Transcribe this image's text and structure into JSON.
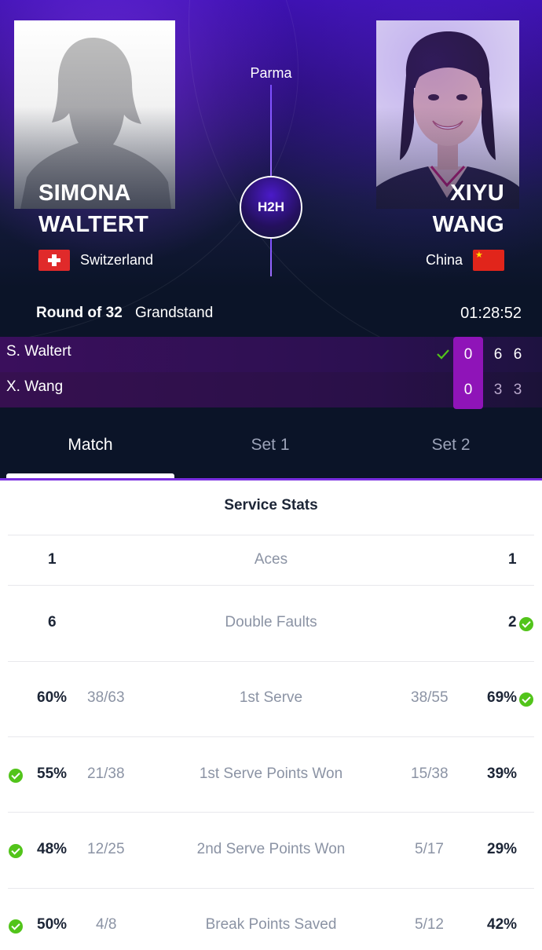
{
  "match": {
    "venue": "Parma",
    "h2h_label": "H2H",
    "round": "Round of 32",
    "court": "Grandstand",
    "duration": "01:28:52"
  },
  "players": {
    "left": {
      "first": "SIMONA",
      "last": "WALTERT",
      "country": "Switzerland",
      "short": "S. Waltert",
      "points": "0",
      "sets": [
        "6",
        "6"
      ],
      "winner": true
    },
    "right": {
      "first": "XIYU",
      "last": "WANG",
      "country": "China",
      "short": "X. Wang",
      "points": "0",
      "sets": [
        "3",
        "3"
      ],
      "winner": false
    }
  },
  "tabs": [
    {
      "label": "Match",
      "active": true
    },
    {
      "label": "Set 1",
      "active": false
    },
    {
      "label": "Set 2",
      "active": false
    }
  ],
  "stats": {
    "title": "Service Stats",
    "rows": [
      {
        "label": "Aces",
        "left": "1",
        "right": "1",
        "left_frac": "",
        "right_frac": "",
        "left_best": false,
        "right_best": false
      },
      {
        "label": "Double Faults",
        "left": "6",
        "right": "2",
        "left_frac": "",
        "right_frac": "",
        "left_best": false,
        "right_best": true
      },
      {
        "label": "1st Serve",
        "left": "60%",
        "right": "69%",
        "left_frac": "38/63",
        "right_frac": "38/55",
        "left_best": false,
        "right_best": true
      },
      {
        "label": "1st Serve Points Won",
        "left": "55%",
        "right": "39%",
        "left_frac": "21/38",
        "right_frac": "15/38",
        "left_best": true,
        "right_best": false
      },
      {
        "label": "2nd Serve Points Won",
        "left": "48%",
        "right": "29%",
        "left_frac": "12/25",
        "right_frac": "5/17",
        "left_best": true,
        "right_best": false
      },
      {
        "label": "Break Points Saved",
        "left": "50%",
        "right": "42%",
        "left_frac": "4/8",
        "right_frac": "5/12",
        "left_best": true,
        "right_best": false
      }
    ]
  },
  "colors": {
    "accent": "#8f14b8",
    "check": "#52c41a",
    "header_bg": "#0b1428"
  },
  "icons": {
    "winner": "check-icon",
    "best_stat": "check-circle-icon"
  }
}
